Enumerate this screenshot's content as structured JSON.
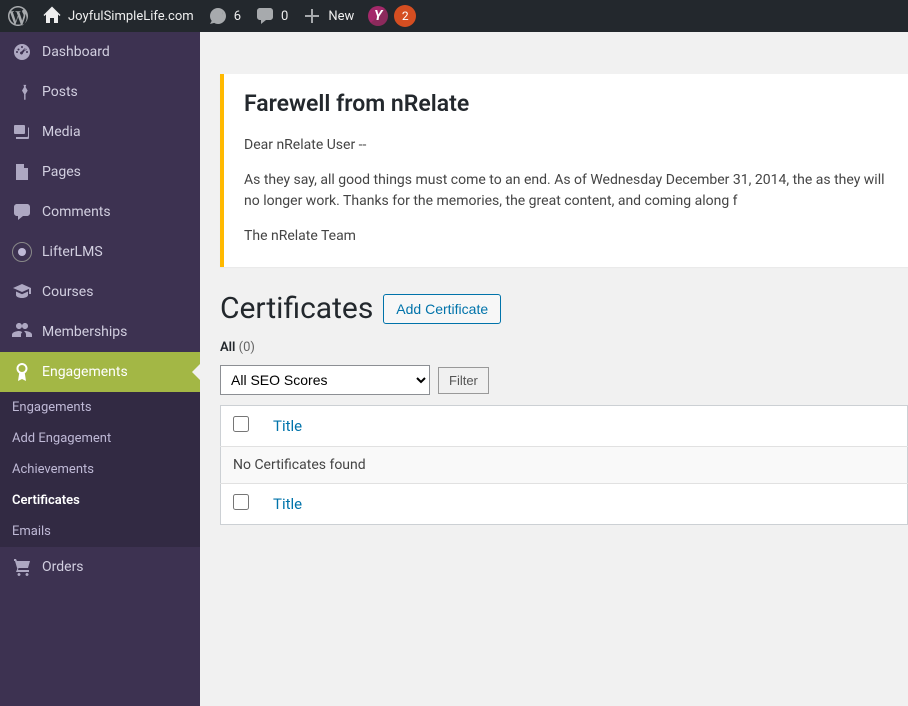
{
  "adminbar": {
    "site_name": "JoyfulSimpleLife.com",
    "updates_count": "6",
    "comments_count": "0",
    "new_label": "New",
    "yoast_badge": "2"
  },
  "sidebar": {
    "dashboard": "Dashboard",
    "posts": "Posts",
    "media": "Media",
    "pages": "Pages",
    "comments": "Comments",
    "lifterlms": "LifterLMS",
    "courses": "Courses",
    "memberships": "Memberships",
    "engagements": "Engagements",
    "orders": "Orders",
    "submenu": {
      "engagements": "Engagements",
      "add_engagement": "Add Engagement",
      "achievements": "Achievements",
      "certificates": "Certificates",
      "emails": "Emails"
    }
  },
  "notice": {
    "title": "Farewell from nRelate",
    "p1": "Dear nRelate User --",
    "p2": "As they say, all good things must come to an end. As of Wednesday December 31, 2014, the as they will no longer work. Thanks for the memories, the great content, and coming along f",
    "p3": "The nRelate Team"
  },
  "page": {
    "heading": "Certificates",
    "add_button": "Add Certificate",
    "filter_all_label": "All",
    "filter_all_count": "(0)",
    "seo_select": "All SEO Scores",
    "filter_button": "Filter",
    "column_title": "Title",
    "empty_text": "No Certificates found"
  }
}
